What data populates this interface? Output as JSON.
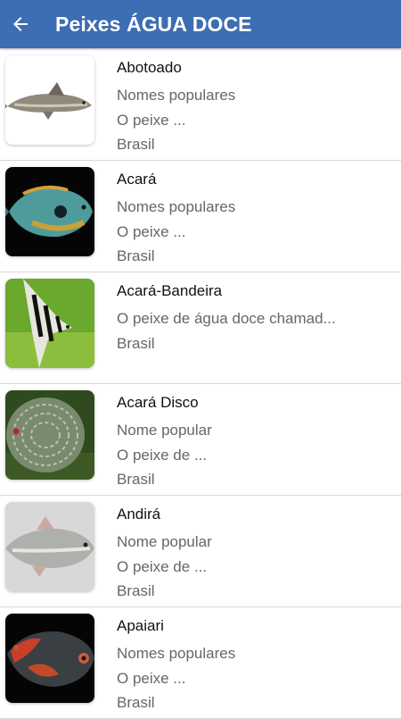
{
  "app_bar": {
    "title": "Peixes ÁGUA DOCE",
    "back_icon": "arrow-left-icon",
    "background": "#3d6db2"
  },
  "fish_list": [
    {
      "name": "Abotoado",
      "lines": [
        "Nomes populares",
        "O peixe ...",
        "Brasil"
      ],
      "image": "abotoado-fish"
    },
    {
      "name": "Acará",
      "lines": [
        "Nomes populares",
        "O peixe ...",
        "Brasil"
      ],
      "image": "acara-fish"
    },
    {
      "name": "Acará-Bandeira",
      "lines": [
        "O peixe de água doce chamad...",
        "Brasil"
      ],
      "image": "angelfish"
    },
    {
      "name": "Acará Disco",
      "lines": [
        "Nome popular",
        "O peixe de ...",
        "Brasil"
      ],
      "image": "discus-fish"
    },
    {
      "name": "Andirá",
      "lines": [
        "Nome popular",
        "O peixe de ...",
        "Brasil"
      ],
      "image": "andira-fish"
    },
    {
      "name": "Apaiari",
      "lines": [
        "Nomes populares",
        "O peixe ...",
        "Brasil"
      ],
      "image": "oscar-fish"
    }
  ]
}
